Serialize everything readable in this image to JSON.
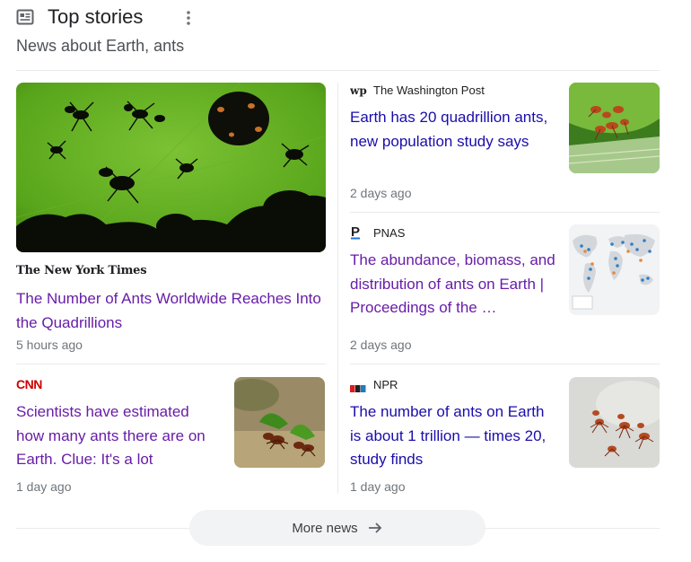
{
  "header": {
    "title": "Top stories",
    "subtitle": "News about Earth, ants"
  },
  "stories": [
    {
      "source": "The New York Times",
      "source_logo_text": "The New York Times",
      "headline": "The Number of Ants Worldwide Reaches Into the Quadrillions",
      "time": "5 hours ago",
      "visited": true
    },
    {
      "source": "The Washington Post",
      "source_logo_text": "wp",
      "headline": "Earth has 20 quadrillion ants, new population study says",
      "time": "2 days ago",
      "visited": false
    },
    {
      "source": "PNAS",
      "source_logo_text": "P",
      "headline": "The abundance, biomass, and distribution of ants on Earth | Proceedings of the …",
      "time": "2 days ago",
      "visited": true
    },
    {
      "source": "CNN",
      "source_logo_text": "CNN",
      "headline": "Scientists have estimated how many ants there are on Earth. Clue: It's a lot",
      "time": "1 day ago",
      "visited": true
    },
    {
      "source": "NPR",
      "source_logo_text": "NPR",
      "headline": "The number of ants on Earth is about 1 trillion — times 20, study finds",
      "time": "1 day ago",
      "visited": false
    }
  ],
  "more_button": {
    "label": "More news",
    "icon": "arrow-right-icon"
  },
  "colors": {
    "visited_link": "#681da8",
    "link": "#1a0dab",
    "cnn_red": "#cc0000",
    "leaf_green": "#5aa81e"
  }
}
